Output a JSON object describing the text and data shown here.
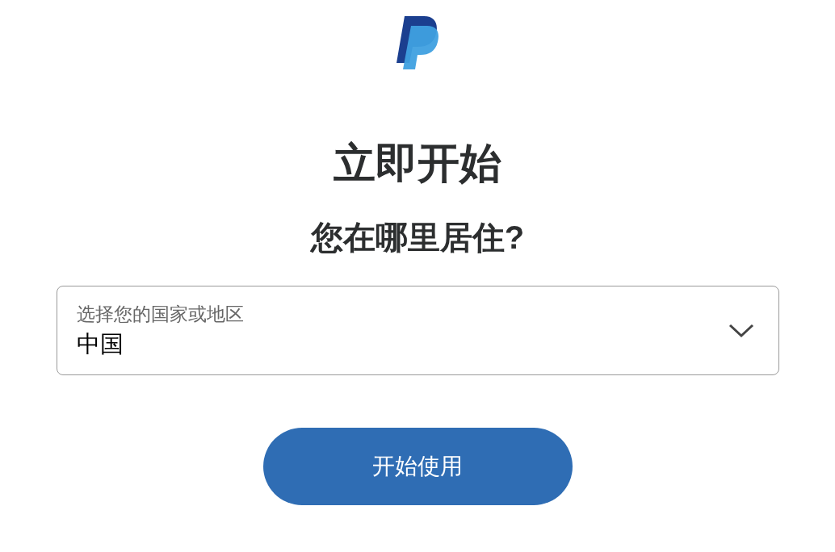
{
  "heading": "立即开始",
  "question": "您在哪里居住?",
  "country_select": {
    "label": "选择您的国家或地区",
    "value": "中国"
  },
  "button": "开始使用"
}
